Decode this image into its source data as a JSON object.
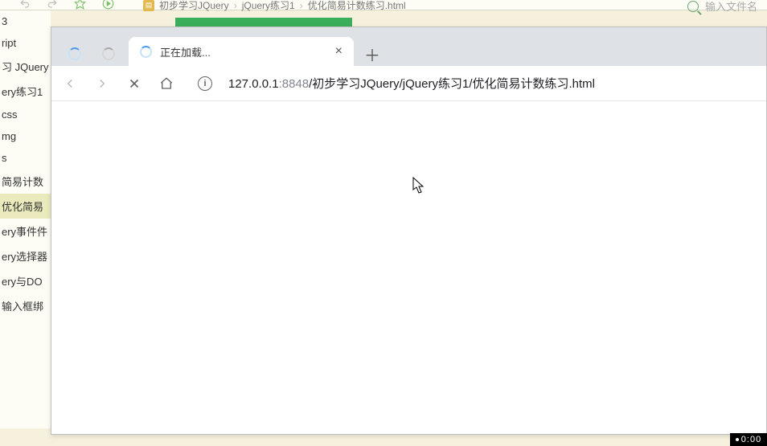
{
  "ide": {
    "breadcrumb": [
      "初步学习JQuery",
      "jQuery练习1",
      "优化简易计数练习.html"
    ],
    "search_placeholder": "输入文件名",
    "files": [
      "3",
      "ript",
      "习 JQuery",
      "ery练习1",
      "css",
      "mg",
      "s",
      "简易计数",
      "优化简易",
      "ery事件件",
      "ery选择器",
      "ery与DO",
      "输入框绑"
    ]
  },
  "browser": {
    "tab_title": "正在加载...",
    "close_label": "×",
    "newtab_label": "＋",
    "url": {
      "full": "127.0.0.1:8848/初步学习JQuery/jQuery练习1/优化简易计数练习.html",
      "host": "127.0.0.1",
      "port": ":8848",
      "path": "/初步学习JQuery/jQuery练习1/优化简易计数练习.html"
    }
  },
  "clock": "0:00"
}
